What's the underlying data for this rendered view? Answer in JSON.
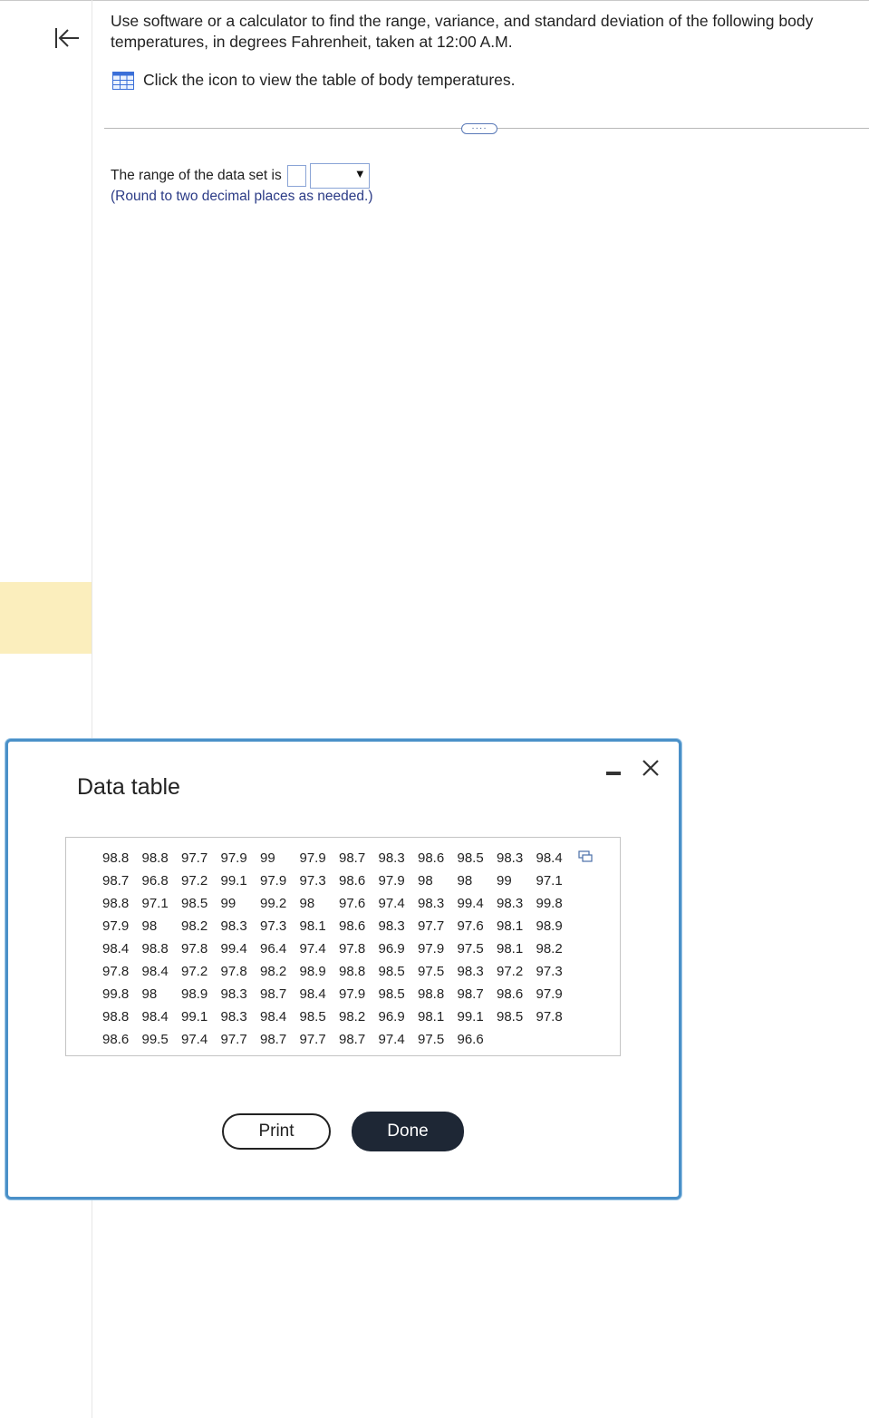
{
  "question": {
    "text": "Use software or a calculator to find the range, variance, and standard deviation of the following body temperatures, in degrees Fahrenheit, taken at 12:00 A.M.",
    "table_link": "Click the icon to view the table of body temperatures."
  },
  "more_button": "····",
  "answer": {
    "range_prompt": "The range of the data set is",
    "range_value": "",
    "unit_value": "",
    "hint": "(Round to two decimal places as needed.)"
  },
  "dialog": {
    "title": "Data table",
    "print_label": "Print",
    "done_label": "Done",
    "rows": [
      [
        "98.8",
        "98.8",
        "97.7",
        "97.9",
        "99",
        "97.9",
        "98.7",
        "98.3",
        "98.6",
        "98.5",
        "98.3",
        "98.4"
      ],
      [
        "98.7",
        "96.8",
        "97.2",
        "99.1",
        "97.9",
        "97.3",
        "98.6",
        "97.9",
        "98",
        "98",
        "99",
        "97.1"
      ],
      [
        "98.8",
        "97.1",
        "98.5",
        "99",
        "99.2",
        "98",
        "97.6",
        "97.4",
        "98.3",
        "99.4",
        "98.3",
        "99.8"
      ],
      [
        "97.9",
        "98",
        "98.2",
        "98.3",
        "97.3",
        "98.1",
        "98.6",
        "98.3",
        "97.7",
        "97.6",
        "98.1",
        "98.9"
      ],
      [
        "98.4",
        "98.8",
        "97.8",
        "99.4",
        "96.4",
        "97.4",
        "97.8",
        "96.9",
        "97.9",
        "97.5",
        "98.1",
        "98.2"
      ],
      [
        "97.8",
        "98.4",
        "97.2",
        "97.8",
        "98.2",
        "98.9",
        "98.8",
        "98.5",
        "97.5",
        "98.3",
        "97.2",
        "97.3"
      ],
      [
        "99.8",
        "98",
        "98.9",
        "98.3",
        "98.7",
        "98.4",
        "97.9",
        "98.5",
        "98.8",
        "98.7",
        "98.6",
        "97.9"
      ],
      [
        "98.8",
        "98.4",
        "99.1",
        "98.3",
        "98.4",
        "98.5",
        "98.2",
        "96.9",
        "98.1",
        "99.1",
        "98.5",
        "97.8"
      ],
      [
        "98.6",
        "99.5",
        "97.4",
        "97.7",
        "98.7",
        "97.7",
        "98.7",
        "97.4",
        "97.5",
        "96.6"
      ]
    ]
  },
  "colors": {
    "dialog_border": "#4a90c8",
    "done_bg": "#1e2735",
    "hint_text": "#2b3b86",
    "highlight": "#fbeebd"
  }
}
